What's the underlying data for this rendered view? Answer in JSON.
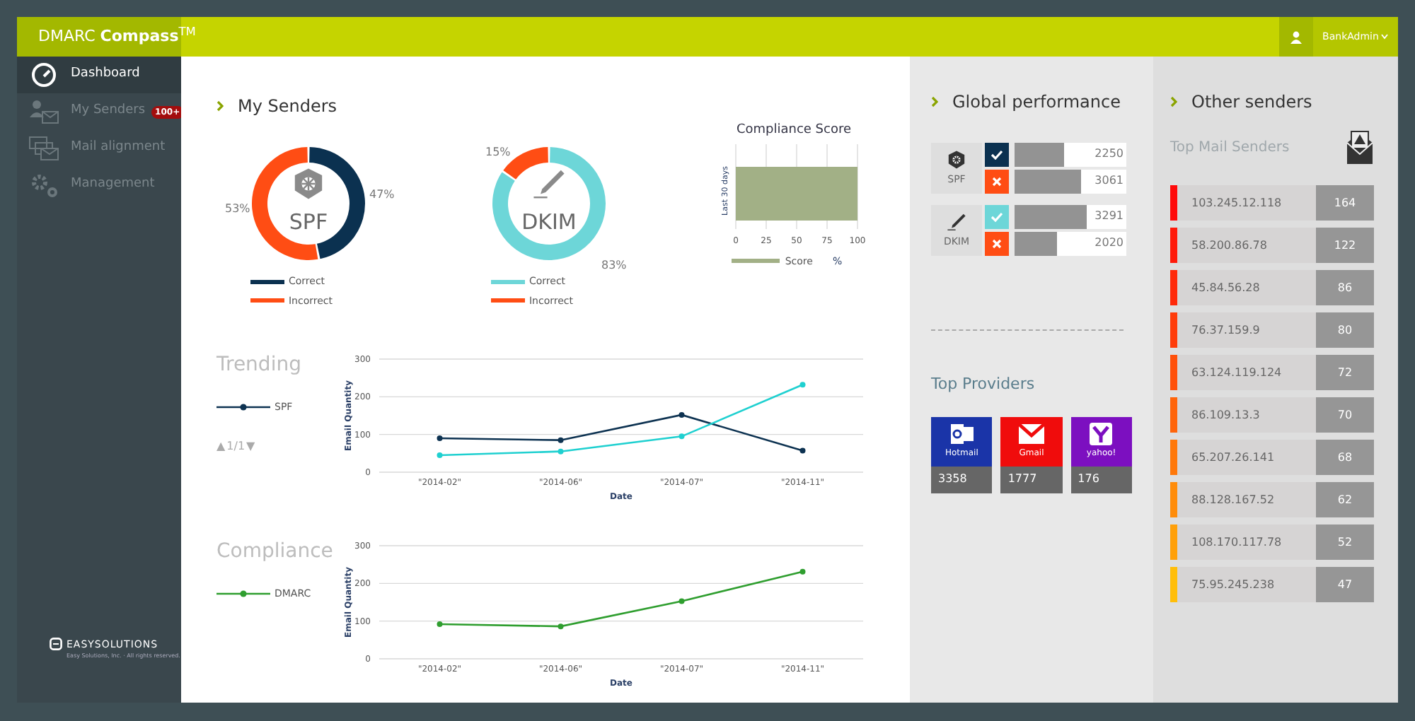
{
  "app": {
    "title": "DMARC **Compass**$^{TM}$",
    "user": "BankAdmin"
  },
  "sidebar": {
    "items": [
      {
        "label": "Dashboard",
        "kind": "dashboard",
        "selected": true
      },
      {
        "label": "My Senders",
        "kind": "senders",
        "selected": false,
        "badge": "100+"
      },
      {
        "label": "Mail alignment",
        "kind": "alignment",
        "selected": false
      },
      {
        "label": "Management",
        "kind": "management",
        "selected": false
      }
    ],
    "footer": {
      "logo": "EASYSOLUTIONS",
      "note": "Easy Solutions, Inc. · All rights reserved."
    }
  },
  "my_senders": {
    "title": "My Senders",
    "donuts": [
      {
        "label": "SPF",
        "kind": "shield",
        "legend": [
          {
            "color": "#0b3150"
          },
          {
            "color": "#ff4d14"
          }
        ],
        "chart_data": {
          "type": "donut",
          "categories": [
            "Correct",
            "Incorrect"
          ],
          "values": [
            47,
            53
          ],
          "value_labels": [
            "47%",
            "53%"
          ]
        }
      },
      {
        "label": "DKIM",
        "kind": "pen",
        "legend": [
          {
            "color": "#6dd6d8"
          },
          {
            "color": "#ff4d14"
          }
        ],
        "chart_data": {
          "type": "donut",
          "categories": [
            "Correct",
            "Incorrect"
          ],
          "values": [
            83,
            15
          ],
          "value_labels": [
            "83%",
            "15%"
          ]
        }
      }
    ],
    "score": {
      "chart_data": {
        "type": "bar",
        "orientation": "horizontal",
        "title": "Compliance Score",
        "categories": [
          "Last 30 days"
        ],
        "series": [
          {
            "name": "Score",
            "color": "#a2b086",
            "values": [
              100
            ]
          }
        ],
        "xlabel": "%",
        "grid": true,
        "xlim": [
          0,
          100
        ],
        "xticks": [
          0,
          25,
          50,
          75,
          100
        ]
      }
    }
  },
  "trending": {
    "title": "Trending",
    "pager": {
      "prev": "▲",
      "text": "1/1",
      "next": "▼"
    },
    "chart_data": {
      "type": "line",
      "xlabel": "Date",
      "ylabel": "Email Quantity",
      "categories": [
        "\"2014-02\"",
        "\"2014-06\"",
        "\"2014-07\"",
        "\"2014-11\""
      ],
      "ylim": [
        0,
        300
      ],
      "yticks": [
        0,
        100,
        200,
        300
      ],
      "series": [
        {
          "name": "SPF",
          "color": "#0d3251",
          "marker": "circle",
          "values": [
            90,
            85,
            152,
            57
          ]
        },
        {
          "color": "#1fd0d0",
          "marker": "circle",
          "values": [
            45,
            55,
            95,
            232
          ]
        }
      ]
    }
  },
  "compliance": {
    "title": "Compliance",
    "chart_data": {
      "type": "line",
      "xlabel": "Date",
      "ylabel": "Email Quantity",
      "categories": [
        "\"2014-02\"",
        "\"2014-06\"",
        "\"2014-07\"",
        "\"2014-11\""
      ],
      "ylim": [
        0,
        300
      ],
      "yticks": [
        0,
        100,
        200,
        300
      ],
      "series": [
        {
          "name": "DMARC",
          "color": "#2f9e2f",
          "marker": "circle",
          "values": [
            92,
            86,
            153,
            231
          ]
        }
      ]
    }
  },
  "global_performance": {
    "title": "Global performance",
    "rows": [
      {
        "label": "SPF",
        "kind": "shield",
        "bars": [
          {
            "kind": "correct",
            "color": "#0b3150",
            "level": 0.44,
            "value": "2250"
          },
          {
            "kind": "incorrect",
            "color": "#ff4d14",
            "level": 0.6,
            "value": "3061"
          }
        ]
      },
      {
        "label": "DKIM",
        "kind": "pen",
        "bars": [
          {
            "kind": "correct",
            "color": "#6dd6d8",
            "level": 0.64,
            "value": "3291"
          },
          {
            "kind": "incorrect",
            "color": "#ff4d14",
            "level": 0.38,
            "value": "2020"
          }
        ]
      }
    ]
  },
  "top_providers": {
    "title": "Top Providers",
    "items": [
      {
        "name": "Hotmail",
        "kind": "outlook",
        "color": "#1a34a8",
        "count": "3358"
      },
      {
        "name": "Gmail",
        "kind": "gmail",
        "color": "#f00c0c",
        "count": "1777"
      },
      {
        "name": "yahoo!",
        "kind": "yahoo",
        "color": "#7c0fc0",
        "count": "176"
      }
    ]
  },
  "other_senders": {
    "title": "Other senders",
    "subtitle": "Top Mail Senders",
    "senders": [
      {
        "ip": "103.245.12.118",
        "count": "164",
        "color": "#ff0a0a"
      },
      {
        "ip": "58.200.86.78",
        "count": "122",
        "color": "#ff1a0a"
      },
      {
        "ip": "45.84.56.28",
        "count": "86",
        "color": "#ff2a0a"
      },
      {
        "ip": "76.37.159.9",
        "count": "80",
        "color": "#ff3c0a"
      },
      {
        "ip": "63.124.119.124",
        "count": "72",
        "color": "#ff500a"
      },
      {
        "ip": "86.109.13.3",
        "count": "70",
        "color": "#ff640a"
      },
      {
        "ip": "65.207.26.141",
        "count": "68",
        "color": "#ff780a"
      },
      {
        "ip": "88.128.167.52",
        "count": "62",
        "color": "#ff8c0a"
      },
      {
        "ip": "108.170.117.78",
        "count": "52",
        "color": "#ffa00a"
      },
      {
        "ip": "75.95.245.238",
        "count": "47",
        "color": "#ffbe0a"
      }
    ]
  }
}
